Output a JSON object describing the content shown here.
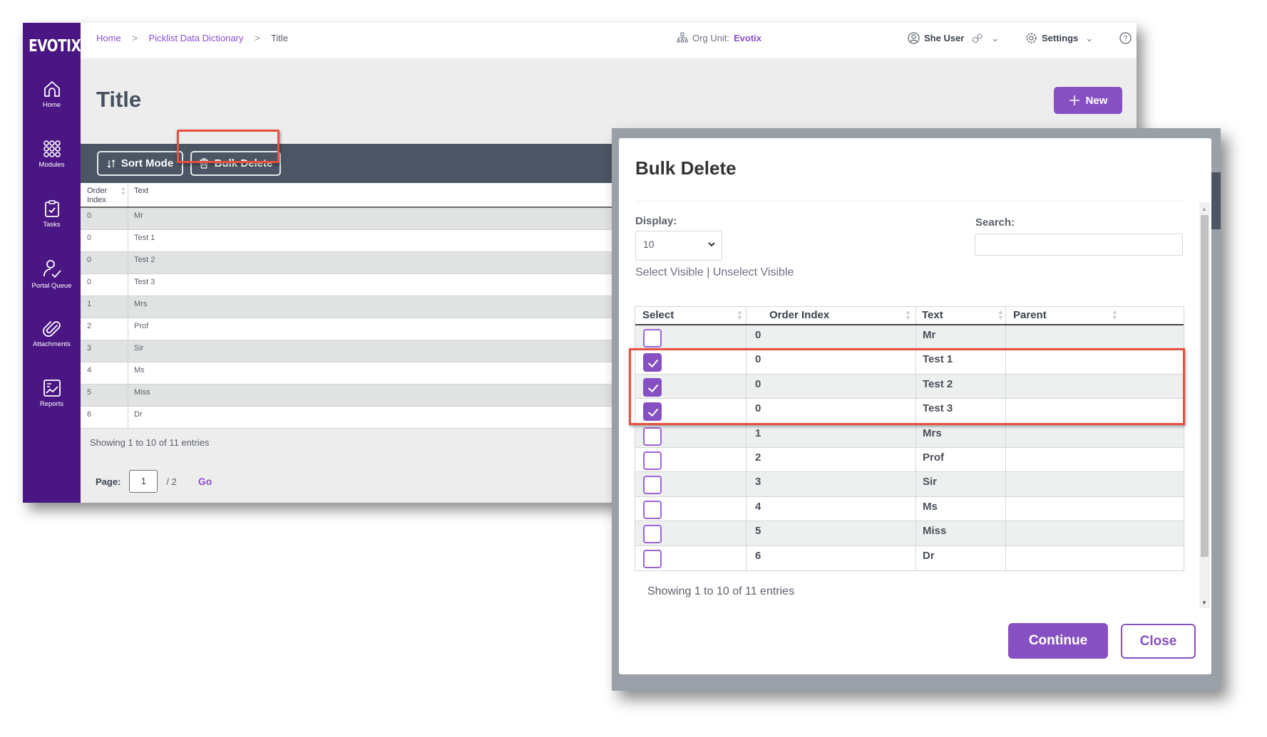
{
  "app": {
    "logo": "EVOTIX",
    "sidebar": [
      {
        "label": "Home",
        "icon": "home-icon"
      },
      {
        "label": "Modules",
        "icon": "modules-grid-icon"
      },
      {
        "label": "Tasks",
        "icon": "clipboard-check-icon"
      },
      {
        "label": "Portal Queue",
        "icon": "user-check-icon"
      },
      {
        "label": "Attachments",
        "icon": "paperclip-icon"
      },
      {
        "label": "Reports",
        "icon": "chart-report-icon"
      }
    ],
    "breadcrumb": [
      "Home",
      "Picklist Data Dictionary",
      "Title"
    ],
    "topbar": {
      "org_unit_label": "Org Unit:",
      "org_unit_value": "Evotix",
      "user_name": "She User",
      "settings_label": "Settings",
      "help_label": "Help"
    },
    "page_title": "Title",
    "new_button": "New",
    "toolbar": {
      "sort_mode": "Sort Mode",
      "bulk_delete": "Bulk Delete"
    },
    "table": {
      "headers": [
        "Order Index",
        "Text"
      ],
      "header_order_line1": "Order",
      "header_order_line2": "Index",
      "rows": [
        {
          "order": "0",
          "text": "Mr"
        },
        {
          "order": "0",
          "text": "Test 1"
        },
        {
          "order": "0",
          "text": "Test 2"
        },
        {
          "order": "0",
          "text": "Test 3"
        },
        {
          "order": "1",
          "text": "Mrs"
        },
        {
          "order": "2",
          "text": "Prof"
        },
        {
          "order": "3",
          "text": "Sir"
        },
        {
          "order": "4",
          "text": "Ms"
        },
        {
          "order": "5",
          "text": "Miss"
        },
        {
          "order": "6",
          "text": "Dr"
        }
      ],
      "showing": "Showing 1 to 10 of 11 entries",
      "page_label": "Page:",
      "page_value": "1",
      "page_total": "/ 2",
      "go": "Go"
    }
  },
  "modal": {
    "title": "Bulk Delete",
    "display_label": "Display:",
    "display_value": "10",
    "select_visible": "Select Visible",
    "link_separator": "|",
    "unselect_visible": "Unselect Visible",
    "search_label": "Search:",
    "search_value": "",
    "headers": [
      "Select",
      "Order Index",
      "Text",
      "Parent"
    ],
    "rows": [
      {
        "checked": false,
        "order": "0",
        "text": "Mr",
        "parent": ""
      },
      {
        "checked": true,
        "order": "0",
        "text": "Test 1",
        "parent": ""
      },
      {
        "checked": true,
        "order": "0",
        "text": "Test 2",
        "parent": ""
      },
      {
        "checked": true,
        "order": "0",
        "text": "Test 3",
        "parent": ""
      },
      {
        "checked": false,
        "order": "1",
        "text": "Mrs",
        "parent": ""
      },
      {
        "checked": false,
        "order": "2",
        "text": "Prof",
        "parent": ""
      },
      {
        "checked": false,
        "order": "3",
        "text": "Sir",
        "parent": ""
      },
      {
        "checked": false,
        "order": "4",
        "text": "Ms",
        "parent": ""
      },
      {
        "checked": false,
        "order": "5",
        "text": "Miss",
        "parent": ""
      },
      {
        "checked": false,
        "order": "6",
        "text": "Dr",
        "parent": ""
      }
    ],
    "showing": "Showing 1 to 10 of 11 entries",
    "continue": "Continue",
    "close": "Close"
  },
  "colors": {
    "sidebar": "#4a1683",
    "accent": "#8750c2",
    "toolbar": "#4b5563",
    "highlight": "#e8503f"
  }
}
